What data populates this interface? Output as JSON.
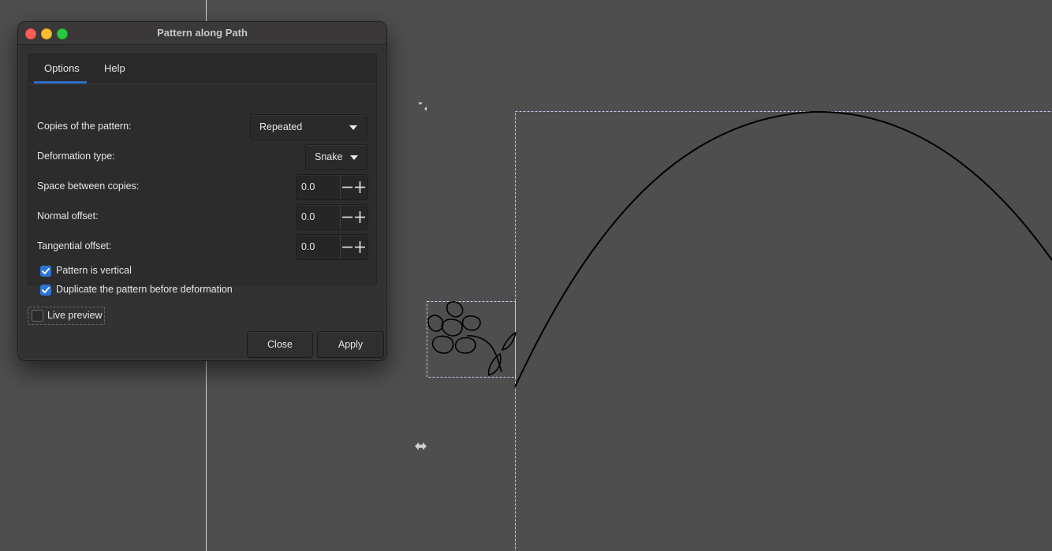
{
  "dialog": {
    "title": "Pattern along Path",
    "tabs": [
      {
        "label": "Options",
        "active": true
      },
      {
        "label": "Help",
        "active": false
      }
    ],
    "options": {
      "copies_label": "Copies of the pattern:",
      "copies_value": "Repeated",
      "deformation_label": "Deformation type:",
      "deformation_value": "Snake",
      "space_label": "Space between copies:",
      "space_value": "0.0",
      "normal_label": "Normal offset:",
      "normal_value": "0.0",
      "tangential_label": "Tangential offset:",
      "tangential_value": "0.0",
      "vertical_label": "Pattern is vertical",
      "vertical_checked": true,
      "duplicate_label": "Duplicate the pattern before deformation",
      "duplicate_checked": true
    },
    "live_preview_label": "Live preview",
    "live_preview_checked": false,
    "close_label": "Close",
    "apply_label": "Apply"
  },
  "canvas": {
    "background_color": "#4e4e4e",
    "accent_color": "#2b74d8"
  }
}
